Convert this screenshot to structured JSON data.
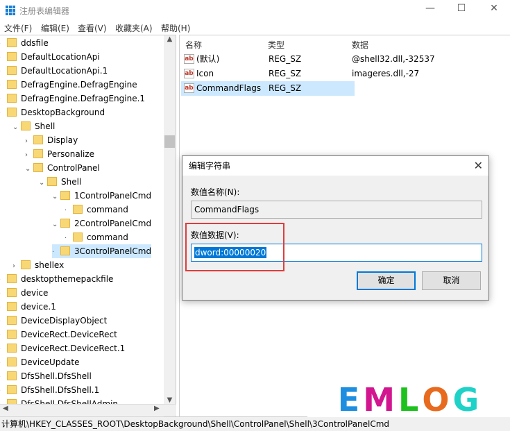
{
  "window": {
    "title": "注册表编辑器",
    "minimize": "—",
    "maximize": "☐",
    "close": "✕"
  },
  "menu": [
    "文件(F)",
    "编辑(E)",
    "查看(V)",
    "收藏夹(A)",
    "帮助(H)"
  ],
  "tree": [
    {
      "label": "ddsfile",
      "level": 0,
      "exp": ""
    },
    {
      "label": "DefaultLocationApi",
      "level": 0,
      "exp": ""
    },
    {
      "label": "DefaultLocationApi.1",
      "level": 0,
      "exp": ""
    },
    {
      "label": "DefragEngine.DefragEngine",
      "level": 0,
      "exp": ""
    },
    {
      "label": "DefragEngine.DefragEngine.1",
      "level": 0,
      "exp": ""
    },
    {
      "label": "DesktopBackground",
      "level": 0,
      "exp": ""
    },
    {
      "label": "Shell",
      "level": 1,
      "exp": "v"
    },
    {
      "label": "Display",
      "level": 2,
      "exp": ">"
    },
    {
      "label": "Personalize",
      "level": 2,
      "exp": ">"
    },
    {
      "label": "ControlPanel",
      "level": 2,
      "exp": "v"
    },
    {
      "label": "Shell",
      "level": 3,
      "exp": "v"
    },
    {
      "label": "1ControlPanelCmd",
      "level": 4,
      "exp": "v"
    },
    {
      "label": "command",
      "level": 5,
      "exp": ""
    },
    {
      "label": "2ControlPanelCmd",
      "level": 4,
      "exp": "v"
    },
    {
      "label": "command",
      "level": 5,
      "exp": ""
    },
    {
      "label": "3ControlPanelCmd",
      "level": 4,
      "exp": "",
      "selected": true
    },
    {
      "label": "shellex",
      "level": 1,
      "exp": ">"
    },
    {
      "label": "desktopthemepackfile",
      "level": 0,
      "exp": ""
    },
    {
      "label": "device",
      "level": 0,
      "exp": ""
    },
    {
      "label": "device.1",
      "level": 0,
      "exp": ""
    },
    {
      "label": "DeviceDisplayObject",
      "level": 0,
      "exp": ""
    },
    {
      "label": "DeviceRect.DeviceRect",
      "level": 0,
      "exp": ""
    },
    {
      "label": "DeviceRect.DeviceRect.1",
      "level": 0,
      "exp": ""
    },
    {
      "label": "DeviceUpdate",
      "level": 0,
      "exp": ""
    },
    {
      "label": "DfsShell.DfsShell",
      "level": 0,
      "exp": ""
    },
    {
      "label": "DfsShell.DfsShell.1",
      "level": 0,
      "exp": ""
    },
    {
      "label": "DfsShell.DfsShellAdmin",
      "level": 0,
      "exp": ""
    }
  ],
  "list": {
    "headers": [
      "名称",
      "类型",
      "数据"
    ],
    "rows": [
      {
        "name": "(默认)",
        "type": "REG_SZ",
        "data": "@shell32.dll,-32537"
      },
      {
        "name": "Icon",
        "type": "REG_SZ",
        "data": "imageres.dll,-27"
      },
      {
        "name": "CommandFlags",
        "type": "REG_SZ",
        "data": "",
        "selected": true
      }
    ]
  },
  "dialog": {
    "title": "编辑字符串",
    "name_label": "数值名称(N):",
    "name_value": "CommandFlags",
    "data_label": "数值数据(V):",
    "data_value": "dword:00000020",
    "ok": "确定",
    "cancel": "取消"
  },
  "status": "计算机\\HKEY_CLASSES_ROOT\\DesktopBackground\\Shell\\ControlPanel\\Shell\\3ControlPanelCmd",
  "watermark": {
    "letters": [
      "E",
      "M",
      "L",
      "O",
      "G"
    ],
    "colors": [
      "#1e8fe0",
      "#d2168f",
      "#1ec21e",
      "#e86a1e",
      "#1ed2c8"
    ]
  }
}
